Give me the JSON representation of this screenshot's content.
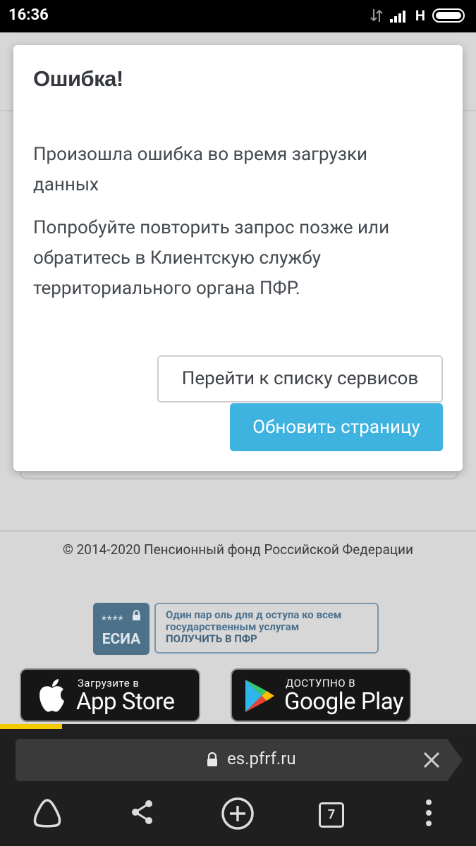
{
  "status_bar": {
    "time": "16:36",
    "network_label": "H"
  },
  "dialog": {
    "title": "Ошибка!",
    "message_line1": "Произошла ошибка во время загрузки данных",
    "message_line2": "Попробуйте повторить запрос позже или обратитесь в Клиентскую службу территориального органа ПФР.",
    "secondary_button": "Перейти к списку сервисов",
    "primary_button": "Обновить страницу",
    "primary_color": "#3eb3e0"
  },
  "footer": {
    "copyright": "© 2014-2020 Пенсионный фонд Российской Федерации",
    "esia": {
      "badge_stars": "****",
      "badge_label": "ЕСИА",
      "banner_line1": "Один пар оль для д оступа ко всем",
      "banner_line2": "государственным услугам",
      "banner_link": "ПОЛУЧИТЬ В ПФР"
    },
    "app_store": {
      "small": "Загрузите в",
      "big": "App Store"
    },
    "google_play": {
      "small": "ДОСТУПНО В",
      "big": "Google Play"
    }
  },
  "browser": {
    "url": "es.pfrf.ru",
    "tab_count": "7",
    "load_progress": 0.13,
    "progress_color": "#f5c800"
  }
}
